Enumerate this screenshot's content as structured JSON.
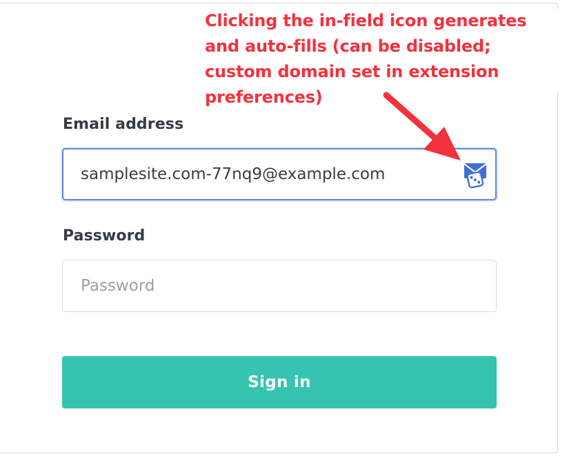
{
  "annotation": {
    "lines": [
      "Clicking the in-field icon generates",
      "and auto-fills (can be disabled;",
      "custom domain set in extension",
      "preferences)"
    ],
    "color": "#f2323c"
  },
  "form": {
    "email": {
      "label": "Email address",
      "value": "samplesite.com-77nq9@example.com",
      "icon": "envelope-dice-icon"
    },
    "password": {
      "label": "Password",
      "placeholder": "Password",
      "value": ""
    },
    "submit": {
      "label": "Sign in",
      "color": "#36c4b0"
    }
  }
}
